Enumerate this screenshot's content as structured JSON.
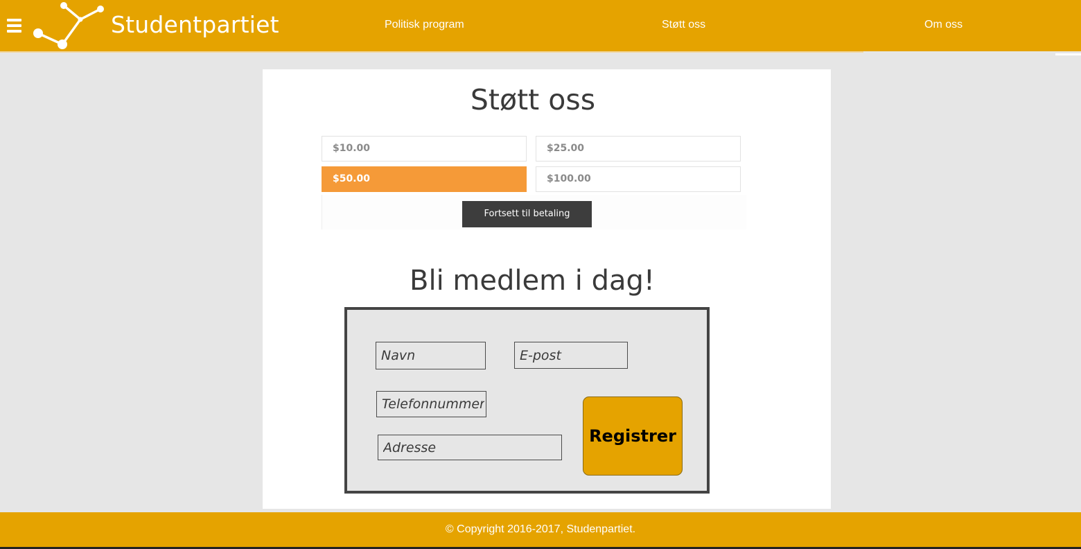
{
  "header": {
    "brand": "Studentpartiet",
    "nav": [
      {
        "label": "Politisk program"
      },
      {
        "label": "Støtt oss"
      },
      {
        "label": "Om oss"
      }
    ],
    "menu_icon": "hamburger-menu-icon",
    "logo_icon": "network-nodes-logo"
  },
  "support": {
    "title": "Støtt oss",
    "amounts": [
      {
        "label": "$10.00",
        "selected": false
      },
      {
        "label": "$25.00",
        "selected": false
      },
      {
        "label": "$50.00",
        "selected": true
      },
      {
        "label": "$100.00",
        "selected": false
      }
    ],
    "continue_label": "Fortsett til betaling"
  },
  "membership": {
    "title": "Bli medlem i dag!",
    "fields": {
      "name_placeholder": "Navn",
      "email_placeholder": "E-post",
      "phone_placeholder": "Telefonnummer",
      "address_placeholder": "Adresse"
    },
    "register_label": "Registrer"
  },
  "footer": {
    "copyright": "© Copyright 2016-2017, Studenpartiet."
  },
  "colors": {
    "brand": "#e5a300",
    "selected_amount": "#f59a38",
    "dark_button": "#3d3d3d",
    "page_background": "#e6e6e6"
  }
}
